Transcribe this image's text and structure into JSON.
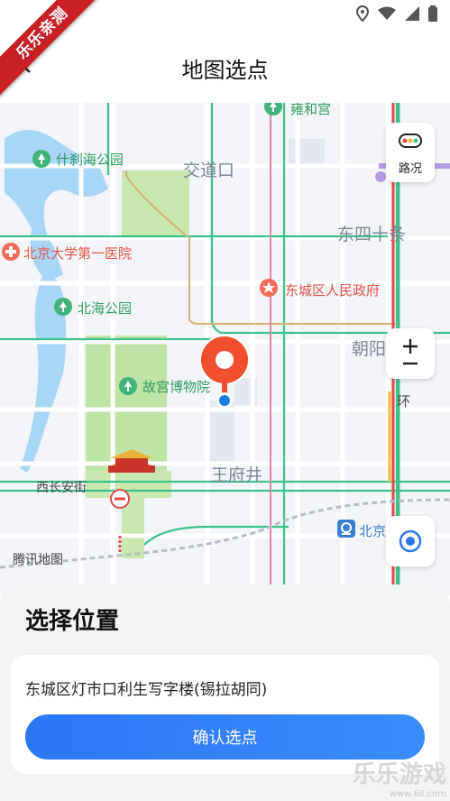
{
  "watermark_ribbon": "乐乐亲测",
  "header": {
    "title": "地图选点"
  },
  "map": {
    "labels": {
      "shichahai": "什刹海公园",
      "jiaodaokou": "交道口",
      "yonghegong": "雍和宫",
      "dongsishitiao": "东四十条",
      "pku_hospital": "北京大学第一医院",
      "beihai": "北海公园",
      "dongcheng_gov": "东城区人民政府",
      "chaoyang": "朝阳",
      "palace_museum": "故宫博物院",
      "wangfujing": "王府井",
      "xichanganjie": "西长安街",
      "beijing_station": "北京",
      "huan": "环",
      "tencent_map": "腾讯地图"
    },
    "controls": {
      "traffic_label": "路况"
    }
  },
  "panel": {
    "title": "选择位置",
    "address": "东城区灯市口利生写字楼(锡拉胡同)",
    "confirm_label": "确认选点"
  },
  "watermark": {
    "brand": "乐乐游戏",
    "url": "www.6ll.com"
  },
  "colors": {
    "primary": "#2c76f4",
    "pin_red": "#f24e2e",
    "green_road": "#3fc08a",
    "park": "#c8e8b0",
    "water": "#a9d6f5"
  }
}
